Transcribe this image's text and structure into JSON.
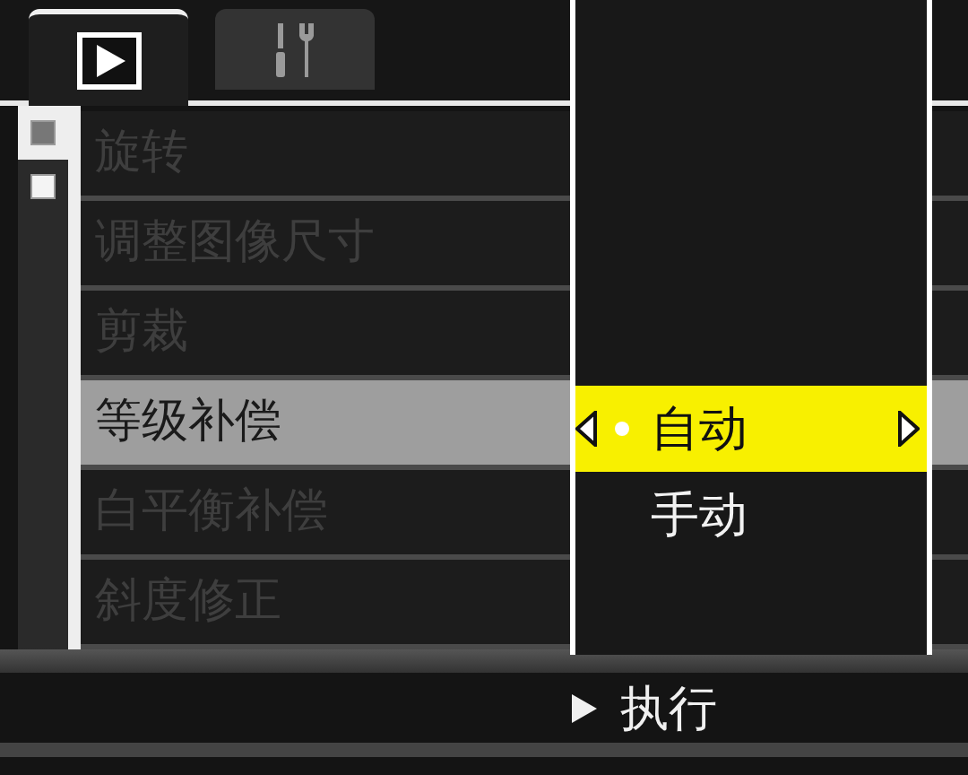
{
  "tabs": [
    {
      "kind": "play",
      "selected": true
    },
    {
      "kind": "setup",
      "selected": false
    }
  ],
  "pages": [
    {
      "selected": true
    },
    {
      "selected": false
    }
  ],
  "menu_items": [
    {
      "label": "旋转",
      "selected": false,
      "disabled": true
    },
    {
      "label": "调整图像尺寸",
      "selected": false,
      "disabled": true
    },
    {
      "label": "剪裁",
      "selected": false,
      "disabled": true
    },
    {
      "label": "等级补偿",
      "selected": true,
      "disabled": false
    },
    {
      "label": "白平衡补偿",
      "selected": false,
      "disabled": true
    },
    {
      "label": "斜度修正",
      "selected": false,
      "disabled": true
    }
  ],
  "options": [
    {
      "label": "自动",
      "selected": true
    },
    {
      "label": "手动",
      "selected": false
    }
  ],
  "footer": {
    "label": "执行"
  }
}
